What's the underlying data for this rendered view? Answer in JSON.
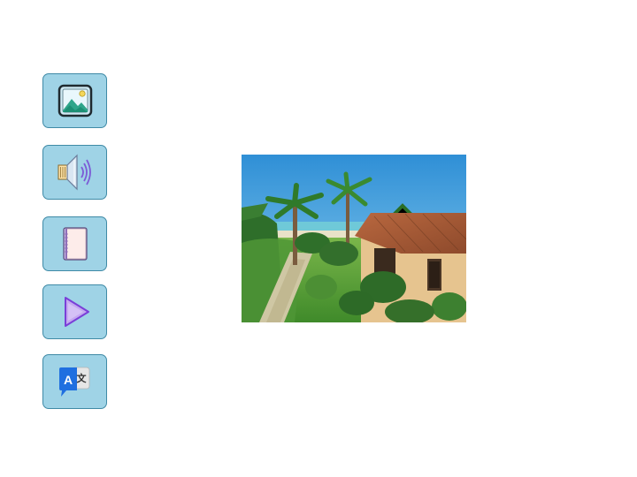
{
  "toolbar": {
    "buttons": [
      {
        "id": "image",
        "icon": "image-icon"
      },
      {
        "id": "audio",
        "icon": "speaker-icon"
      },
      {
        "id": "book",
        "icon": "book-icon"
      },
      {
        "id": "play",
        "icon": "play-icon"
      },
      {
        "id": "translate",
        "icon": "translate-icon",
        "glyph_a": "A",
        "glyph_b": "文"
      }
    ],
    "accent": "#9fd3e6",
    "border": "#3f8aa6"
  },
  "content": {
    "photo_subject": "villa-with-palm-trees"
  }
}
